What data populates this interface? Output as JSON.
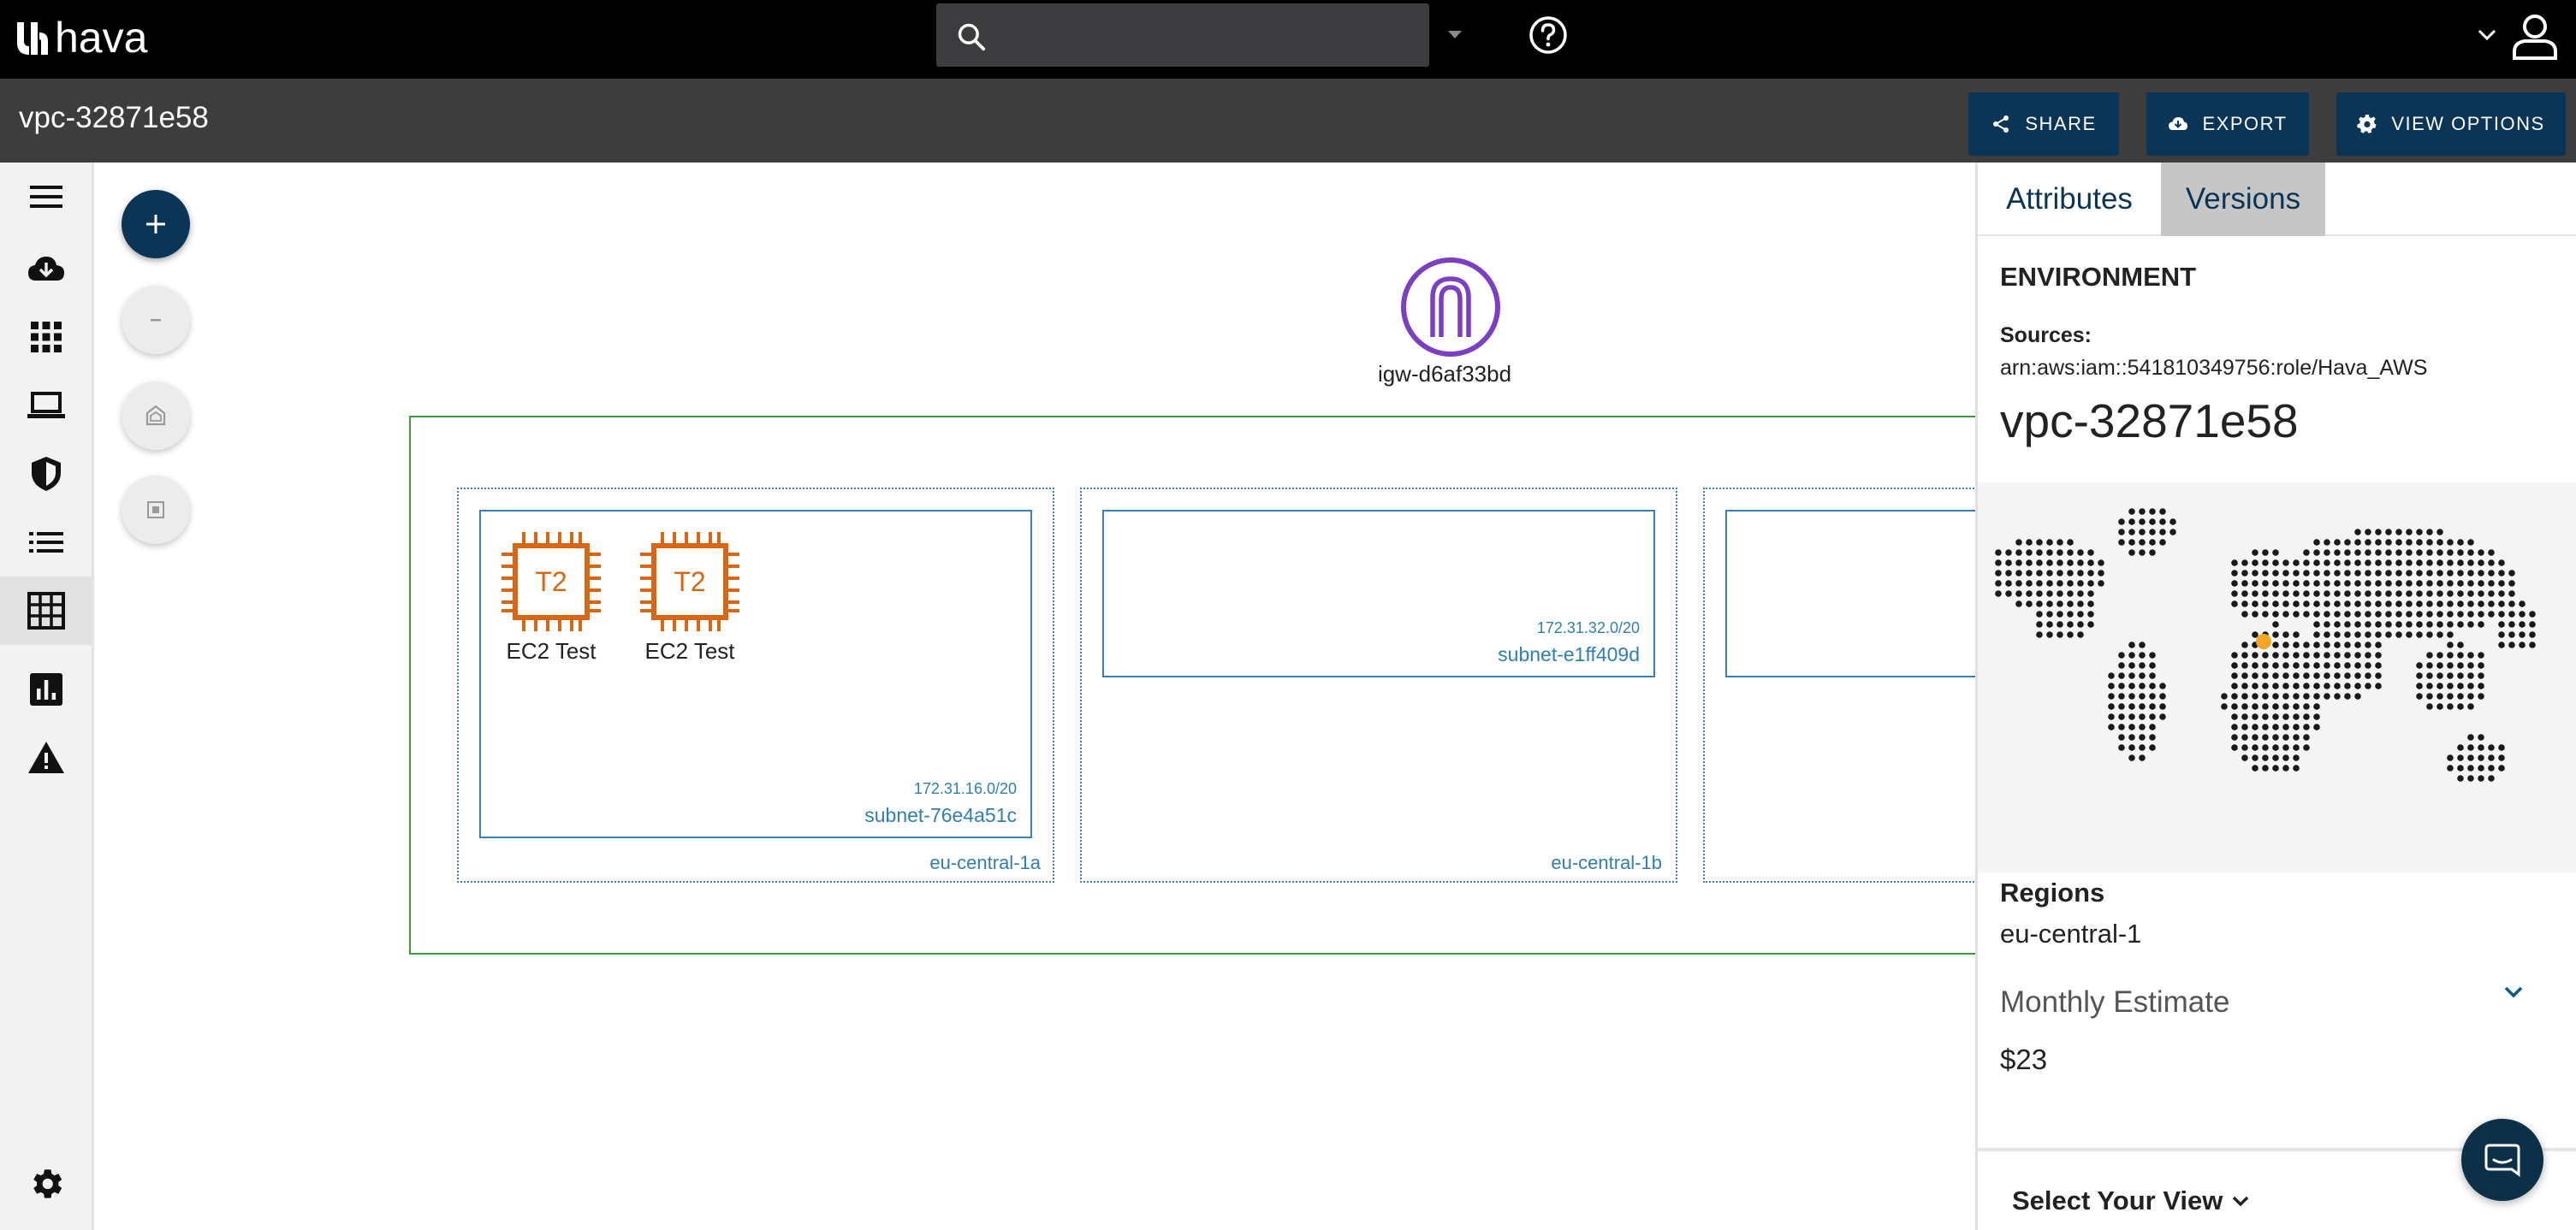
{
  "app": {
    "logo_text": "hava"
  },
  "search": {
    "value": "",
    "placeholder": ""
  },
  "header": {
    "title": "vpc-32871e58"
  },
  "toolbar": {
    "share_label": "SHARE",
    "export_label": "EXPORT",
    "view_options_label": "VIEW OPTIONS"
  },
  "sidebar": {
    "items": [
      {
        "icon": "menu-icon"
      },
      {
        "icon": "cloud-download-icon"
      },
      {
        "icon": "apps-grid-icon"
      },
      {
        "icon": "laptop-icon"
      },
      {
        "icon": "shield-icon"
      },
      {
        "icon": "list-icon"
      },
      {
        "icon": "table-icon"
      },
      {
        "icon": "bar-chart-icon"
      },
      {
        "icon": "warning-icon"
      },
      {
        "icon": "gear-icon"
      }
    ]
  },
  "diagram": {
    "igw": {
      "label": "igw-d6af33bd"
    },
    "azs": [
      {
        "name": "eu-central-1a",
        "subnet": {
          "cidr": "172.31.16.0/20",
          "name": "subnet-76e4a51c",
          "instances": [
            {
              "type": "T2",
              "label": "EC2 Test"
            },
            {
              "type": "T2",
              "label": "EC2 Test"
            }
          ]
        }
      },
      {
        "name": "eu-central-1b",
        "subnet": {
          "cidr": "172.31.32.0/20",
          "name": "subnet-e1ff409d"
        }
      },
      {
        "name": "",
        "subnet": {}
      }
    ]
  },
  "panel": {
    "tabs": [
      "Attributes",
      "Versions"
    ],
    "active_tab": "Versions",
    "environment_heading": "ENVIRONMENT",
    "sources_label": "Sources:",
    "sources_value": "arn:aws:iam::541810349756:role/Hava_AWS",
    "vpc_id": "vpc-32871e58",
    "regions_label": "Regions",
    "regions_value": "eu-central-1",
    "estimate_label": "Monthly Estimate",
    "estimate_value": "$23",
    "select_view_label": "Select Your View"
  },
  "colors": {
    "topbar": "#000000",
    "titlebar": "#3d3d3d",
    "primary_button": "#0b3556",
    "vpc_border": "#3c9a3c",
    "subnet_border": "#3a7eb2",
    "ec2_orange": "#d86613",
    "igw_purple": "#7b3fc4",
    "region_marker": "#f5a623"
  }
}
